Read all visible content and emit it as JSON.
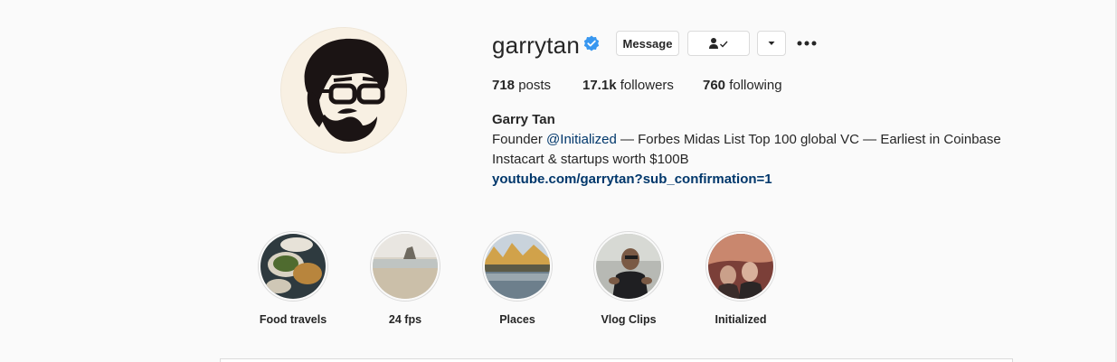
{
  "profile": {
    "username": "garrytan",
    "verified": true,
    "full_name": "Garry Tan",
    "bio_prefix": "Founder ",
    "bio_mention": "@Initialized",
    "bio_line1_rest": " — Forbes Midas List Top 100 global VC — Earliest in Coinbase",
    "bio_line2": "Instacart & startups worth $100B",
    "website": "youtube.com/garrytan?sub_confirmation=1"
  },
  "actions": {
    "message_label": "Message",
    "following_icon": "person-check-icon",
    "dropdown_icon": "caret-down-icon",
    "more_icon": "more-dots-icon"
  },
  "stats": {
    "posts_count": "718",
    "posts_label": " posts",
    "followers_count": "17.1k",
    "followers_label": " followers",
    "following_count": "760",
    "following_label": " following"
  },
  "highlights": [
    {
      "label": "Food travels"
    },
    {
      "label": "24 fps"
    },
    {
      "label": "Places"
    },
    {
      "label": "Vlog Clips"
    },
    {
      "label": "Initialized"
    }
  ],
  "colors": {
    "link": "#00376b",
    "verified": "#3897f0",
    "background": "#fafafa"
  }
}
